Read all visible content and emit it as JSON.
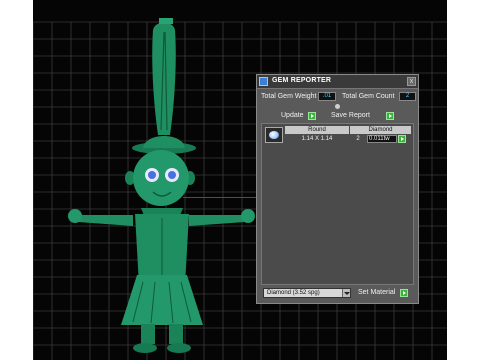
{
  "colors": {
    "grid": "#3a3a3a",
    "figure": "#1f8f62",
    "figure_dark": "#0e5a3c",
    "axis": "#d01818",
    "panel_bg": "#5a5a5a",
    "value_text": "#4fd0ff",
    "go_button": "#3bb23b"
  },
  "panel": {
    "title": "GEM REPORTER",
    "close_label": "x",
    "total_weight_label": "Total Gem Weight",
    "total_weight_value": ".01",
    "total_count_label": "Total Gem Count",
    "total_count_value": "2",
    "update_label": "Update",
    "save_report_label": "Save Report",
    "table": {
      "shape_header": "Round",
      "type_header": "Diamond",
      "size": "1.14 X 1.14",
      "count": "2",
      "weight": "0.011tw"
    },
    "material_select": "Diamond     (3.52 spg)",
    "set_material_label": "Set Material"
  },
  "icons": {
    "app": "gem-reporter-icon",
    "gem": "diamond-thumbnail-icon",
    "go": "green-arrow-icon",
    "dropdown": "chevron-down-icon"
  }
}
